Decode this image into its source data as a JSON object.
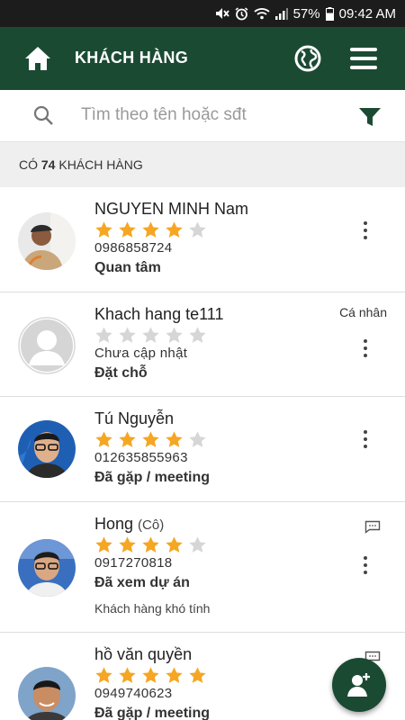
{
  "status_bar": {
    "battery": "57%",
    "time": "09:42 AM"
  },
  "header": {
    "title": "KHÁCH HÀNG"
  },
  "search": {
    "placeholder": "Tìm theo tên hoặc sđt"
  },
  "summary": {
    "prefix": "CÓ",
    "count": "74",
    "suffix": "KHÁCH HÀNG"
  },
  "colors": {
    "primary": "#1b4a33",
    "star_on": "#f5a623",
    "star_off": "#d6d6d6"
  },
  "customers": [
    {
      "name": "NGUYEN MINH Nam",
      "salutation": "",
      "rating": 4,
      "phone": "0986858724",
      "status": "Quan tâm",
      "tag": "",
      "note": ""
    },
    {
      "name": "Khach hang te111",
      "salutation": "",
      "rating": 0,
      "phone": "Chưa cập nhật",
      "status": "Đặt chỗ",
      "tag": "Cá nhân",
      "note": ""
    },
    {
      "name": "Tú Nguyễn",
      "salutation": "",
      "rating": 4,
      "phone": "012635855963",
      "status": "Đã gặp / meeting",
      "tag": "",
      "note": ""
    },
    {
      "name": "Hong",
      "salutation": "(Cô)",
      "rating": 4,
      "phone": "0917270818",
      "status": "Đã xem dự án",
      "tag": "",
      "note": "Khách hàng khó tính"
    },
    {
      "name": "hồ văn quyền",
      "salutation": "",
      "rating": 5,
      "phone": "0949740623",
      "status": "Đã gặp / meeting",
      "tag": "",
      "note": ""
    }
  ],
  "icons": {
    "header": [
      "home-icon",
      "globe-icon",
      "menu-icon"
    ],
    "search": [
      "search-icon",
      "filter-icon"
    ],
    "row": [
      "more-vert-icon",
      "message-icon"
    ],
    "fab": "add-person-icon"
  }
}
